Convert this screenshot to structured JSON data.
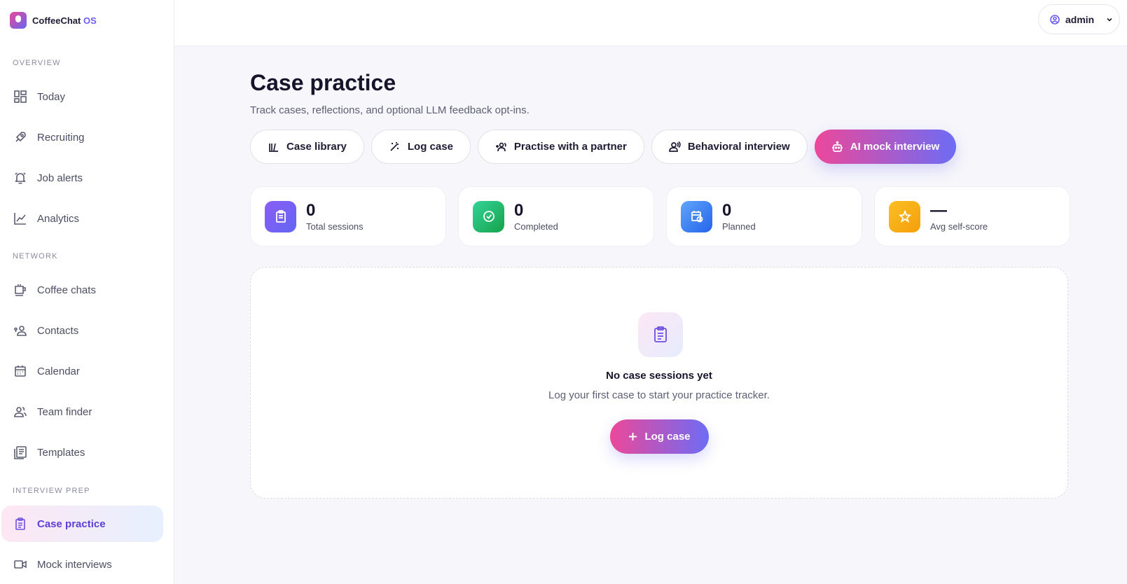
{
  "brand": {
    "name": "CoffeeChat",
    "suffix": "OS"
  },
  "sidebar": {
    "sections": [
      "OVERVIEW",
      "NETWORK",
      "INTERVIEW PREP"
    ],
    "items": [
      {
        "label": "Today",
        "icon": "dashboard-icon"
      },
      {
        "label": "Recruiting",
        "icon": "rocket-icon"
      },
      {
        "label": "Job alerts",
        "icon": "bell-icon"
      },
      {
        "label": "Analytics",
        "icon": "chart-line-icon"
      },
      {
        "label": "Coffee chats",
        "icon": "coffee-cup-icon"
      },
      {
        "label": "Contacts",
        "icon": "contacts-icon"
      },
      {
        "label": "Calendar",
        "icon": "calendar-icon"
      },
      {
        "label": "Team finder",
        "icon": "team-icon"
      },
      {
        "label": "Templates",
        "icon": "templates-icon"
      },
      {
        "label": "Case practice",
        "icon": "clipboard-icon",
        "active": true
      },
      {
        "label": "Mock interviews",
        "icon": "video-icon"
      }
    ]
  },
  "topbar": {
    "user": "admin"
  },
  "main": {
    "title": "Case practice",
    "subtitle": "Track cases, reflections, and optional LLM feedback opt-ins.",
    "actions": [
      {
        "label": "Case library",
        "icon": "library-icon"
      },
      {
        "label": "Log case",
        "icon": "magic-wand-icon"
      },
      {
        "label": "Practise with a partner",
        "icon": "partner-icon"
      },
      {
        "label": "Behavioral interview",
        "icon": "speaking-person-icon"
      },
      {
        "label": "AI mock interview",
        "icon": "robot-icon",
        "primary": true
      }
    ],
    "stats": [
      {
        "value": "0",
        "label": "Total sessions",
        "color": "#7c5cf5"
      },
      {
        "value": "0",
        "label": "Completed",
        "color": "#22c55e"
      },
      {
        "value": "0",
        "label": "Planned",
        "color": "#3b82f6"
      },
      {
        "value": "—",
        "label": "Avg self-score",
        "color": "#f59e0b"
      }
    ],
    "empty": {
      "title": "No case sessions yet",
      "subtitle": "Log your first case to start your practice tracker.",
      "button": "Log case"
    }
  },
  "colors": {
    "accent": "#6d5cf5",
    "gradient_start": "#ec4899",
    "gradient_end": "#6d6cf5"
  }
}
